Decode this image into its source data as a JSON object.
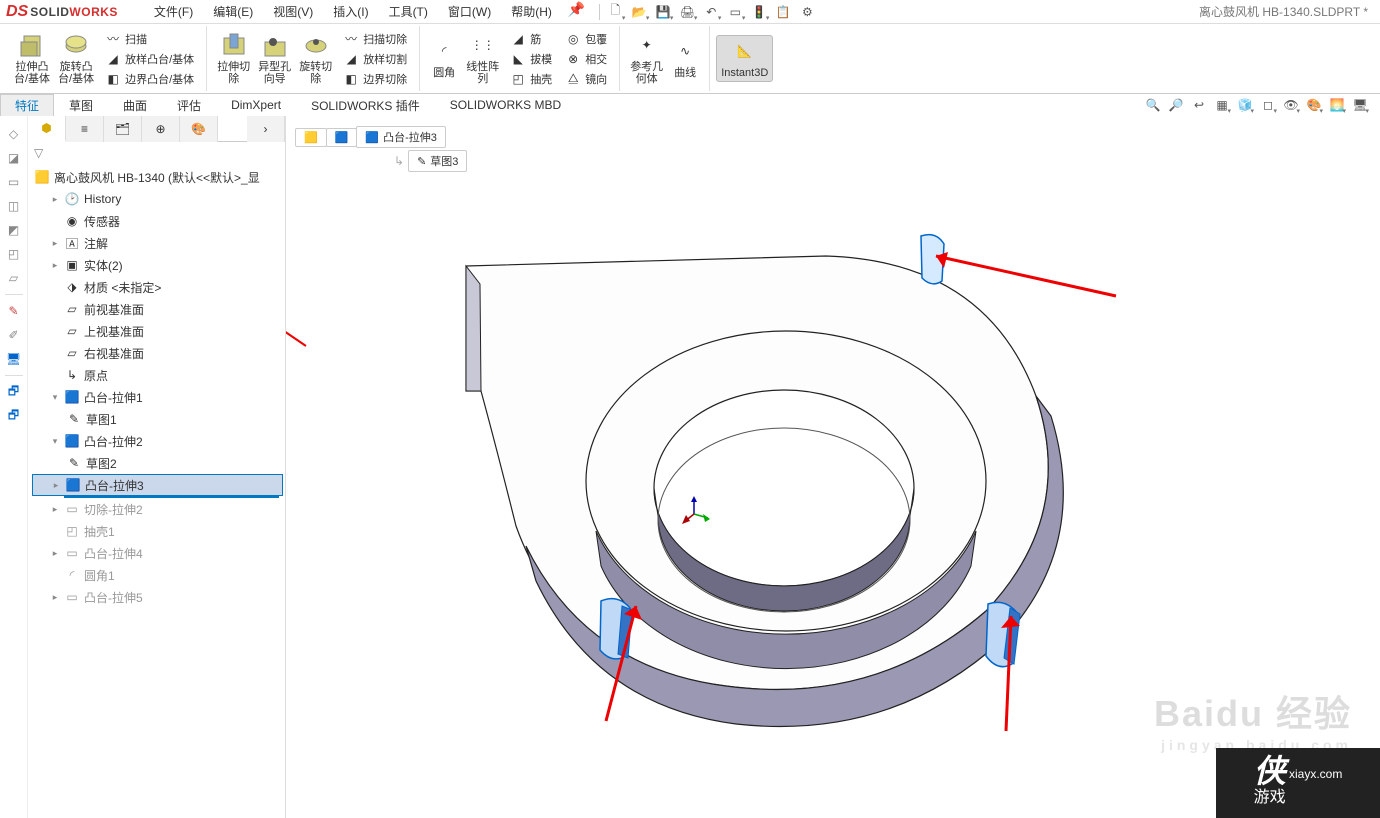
{
  "app": {
    "brand1": "SOLID",
    "brand2": "WORKS"
  },
  "document": {
    "title": "离心鼓风机 HB-1340.SLDPRT *"
  },
  "menu": {
    "file": "文件(F)",
    "edit": "编辑(E)",
    "view": "视图(V)",
    "insert": "插入(I)",
    "tools": "工具(T)",
    "window": "窗口(W)",
    "help": "帮助(H)"
  },
  "ribbon": {
    "extrude_boss": "拉伸凸\n台/基体",
    "revolve_boss": "旋转凸\n台/基体",
    "sweep": "扫描",
    "loft": "放样凸台/基体",
    "boundary": "边界凸台/基体",
    "extrude_cut": "拉伸切\n除",
    "hole_wizard": "异型孔\n向导",
    "revolve_cut": "旋转切\n除",
    "sweep_cut": "扫描切除",
    "loft_cut": "放样切割",
    "boundary_cut": "边界切除",
    "fillet": "圆角",
    "linear_pattern": "线性阵\n列",
    "rib": "筋",
    "draft": "拔模",
    "shell": "抽壳",
    "wrap": "包覆",
    "intersect": "相交",
    "mirror": "镜向",
    "ref_geom": "参考几\n何体",
    "curves": "曲线",
    "instant3d": "Instant3D"
  },
  "tabs": {
    "features": "特征",
    "sketch": "草图",
    "surface": "曲面",
    "evaluate": "评估",
    "dimxpert": "DimXpert",
    "sw_addins": "SOLIDWORKS 插件",
    "sw_mbd": "SOLIDWORKS MBD"
  },
  "tree": {
    "root": "离心鼓风机 HB-1340  (默认<<默认>_显",
    "history": "History",
    "sensors": "传感器",
    "annotations": "注解",
    "bodies": "实体(2)",
    "material": "材质 <未指定>",
    "front": "前视基准面",
    "top": "上视基准面",
    "right": "右视基准面",
    "origin": "原点",
    "boss1": "凸台-拉伸1",
    "sketch1": "草图1",
    "boss2": "凸台-拉伸2",
    "sketch2": "草图2",
    "boss3": "凸台-拉伸3",
    "cut2": "切除-拉伸2",
    "shell1": "抽壳1",
    "boss4": "凸台-拉伸4",
    "fillet1": "圆角1",
    "boss5": "凸台-拉伸5"
  },
  "breadcrumb": {
    "feat": "凸台-拉伸3",
    "sketch": "草图3"
  },
  "watermark": {
    "bd": "Baidu 经验",
    "url": "jingyan.baidu.com",
    "xia": "侠",
    "game": "游戏",
    "site": "xiayx.com"
  }
}
